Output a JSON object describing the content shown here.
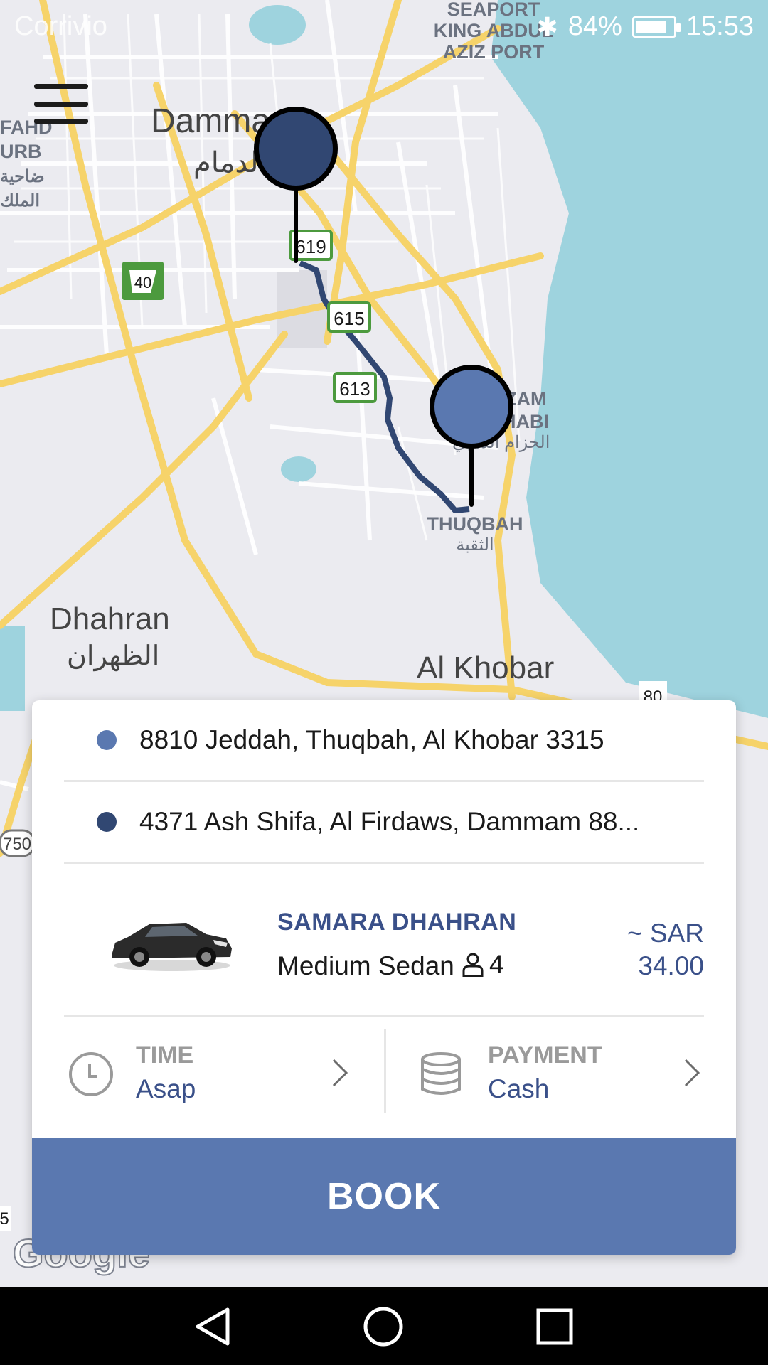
{
  "status_bar": {
    "carrier": "Corrivio",
    "battery": "84%",
    "battery_level": 0.84,
    "time": "15:53"
  },
  "map": {
    "labels": {
      "seaport": "SEAPORT",
      "king_abdulaziz_1": "KING ABDUL",
      "king_abdulaziz_2": "AZIZ PORT",
      "fahd_1": "FAHD",
      "fahd_2": "URB",
      "fahd_ar_1": "ضاحية",
      "fahd_ar_2": "الملك",
      "dammam": "Damma",
      "dammam_ar": "الدمام",
      "azizyah_1": "ZAM",
      "azizyah_2": "HABI",
      "azizyah_ar": "الحزام الذهبي",
      "thuqbah": "THUQBAH",
      "thuqbah_ar": "الثقبة",
      "dhahran": "Dhahran",
      "dhahran_ar": "الظهران",
      "al_khobar": "Al Khobar",
      "google": "Google"
    },
    "road_shields": [
      "619",
      "615",
      "613",
      "40",
      "80",
      "750",
      "5"
    ]
  },
  "trip": {
    "pickup": "8810 Jeddah, Thuqbah, Al Khobar 3315",
    "dropoff": "4371 Ash Shifa, Al Firdaws, Dammam 88...",
    "pickup_color": "#5a78b0",
    "dropoff_color": "#314772"
  },
  "vehicle": {
    "provider": "SAMARA DHAHRAN",
    "type": "Medium Sedan",
    "seats": "4",
    "price_currency": "~ SAR",
    "price_value": "34.00"
  },
  "options": {
    "time_label": "TIME",
    "time_value": "Asap",
    "payment_label": "PAYMENT",
    "payment_value": "Cash"
  },
  "book_label": "BOOK",
  "icons": [
    "menu-icon",
    "bluetooth-icon",
    "battery-icon",
    "pickup-pin-icon",
    "dropoff-pin-icon",
    "car-icon",
    "person-icon",
    "clock-icon",
    "wallet-icon",
    "chevron-right-icon",
    "back-icon",
    "home-icon",
    "recents-icon"
  ]
}
